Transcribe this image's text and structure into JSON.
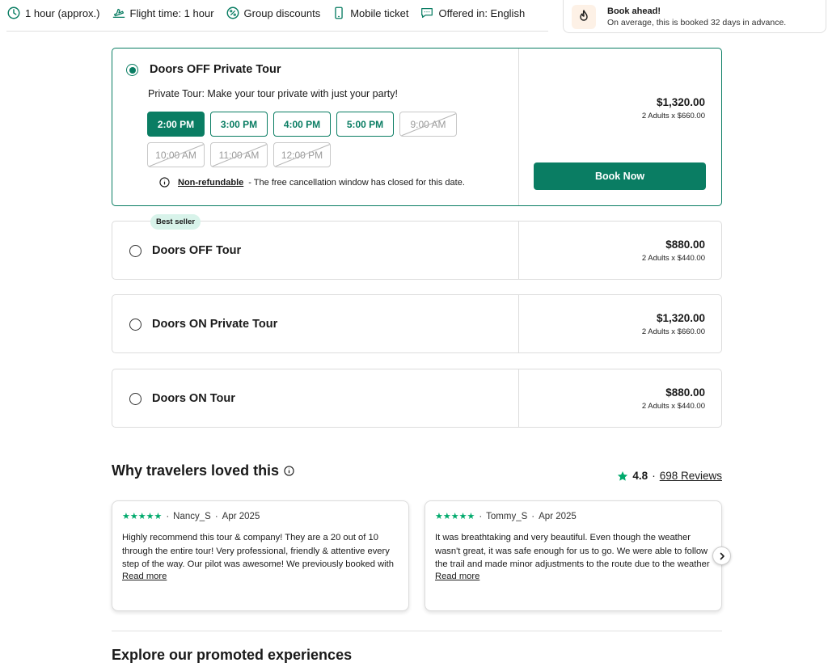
{
  "features": [
    {
      "icon": "clock-icon",
      "label": "1 hour (approx.)"
    },
    {
      "icon": "plane-icon",
      "label": "Flight time: 1 hour"
    },
    {
      "icon": "percent-icon",
      "label": "Group discounts"
    },
    {
      "icon": "phone-icon",
      "label": "Mobile ticket"
    },
    {
      "icon": "chat-icon",
      "label": "Offered in: English"
    }
  ],
  "book_ahead": {
    "title": "Book ahead!",
    "subtitle": "On average, this is booked 32 days in advance."
  },
  "options": [
    {
      "title": "Doors OFF Private Tour",
      "selected": true,
      "description": "Private Tour: Make your tour private with just your party!",
      "slots": [
        {
          "label": "2:00 PM",
          "state": "active"
        },
        {
          "label": "3:00 PM",
          "state": "available"
        },
        {
          "label": "4:00 PM",
          "state": "available"
        },
        {
          "label": "5:00 PM",
          "state": "available"
        },
        {
          "label": "9:00 AM",
          "state": "disabled"
        },
        {
          "label": "10:00 AM",
          "state": "disabled"
        },
        {
          "label": "11:00 AM",
          "state": "disabled"
        },
        {
          "label": "12:00 PM",
          "state": "disabled"
        }
      ],
      "refund_link": "Non-refundable",
      "refund_text": "- The free cancellation window has closed for this date.",
      "price": "$1,320.00",
      "breakdown": "2 Adults x $660.00",
      "cta": "Book Now"
    },
    {
      "title": "Doors OFF Tour",
      "badge": "Best seller",
      "price": "$880.00",
      "breakdown": "2 Adults x $440.00"
    },
    {
      "title": "Doors ON Private Tour",
      "price": "$1,320.00",
      "breakdown": "2 Adults x $660.00"
    },
    {
      "title": "Doors ON Tour",
      "price": "$880.00",
      "breakdown": "2 Adults x $440.00"
    }
  ],
  "why": {
    "title": "Why travelers loved this",
    "rating": "4.8",
    "separator": "·",
    "reviews_link": "698 Reviews"
  },
  "reviews": [
    {
      "stars": "★★★★★",
      "author": "Nancy_S",
      "date": "Apr 2025",
      "text": "Highly recommend this tour & company! They are a 20 out of 10 through the entire tour! Very professional, friendly & attentive every step of the way. Our pilot was awesome! We previously booked with AI",
      "more": "Read more"
    },
    {
      "stars": "★★★★★",
      "author": "Tommy_S",
      "date": "Apr 2025",
      "text": "It was breathtaking and very beautiful. Even though the weather wasn't great, it was safe enough for us to go. We were able to follow the trail and made minor adjustments to the route due to the weather inclemen",
      "more": "Read more"
    }
  ],
  "explore_title": "Explore our promoted experiences",
  "colors": {
    "brand": "#0a7d63",
    "star": "#00aa6c"
  }
}
